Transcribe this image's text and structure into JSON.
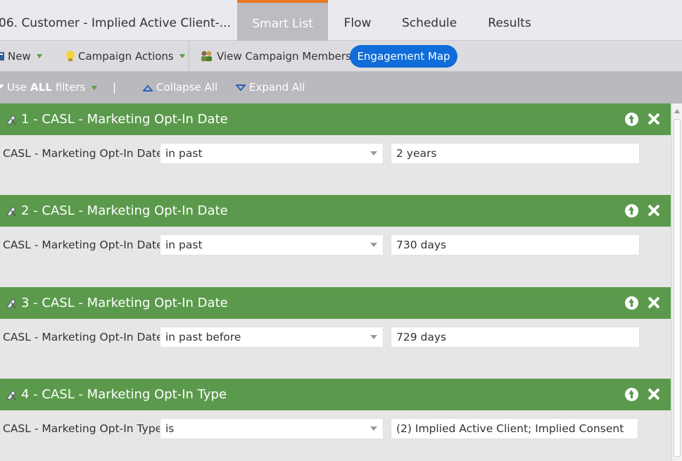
{
  "program_name": "06. Customer - Implied Active Client-...",
  "tabs": [
    {
      "label": "Smart List",
      "active": true
    },
    {
      "label": "Flow",
      "active": false
    },
    {
      "label": "Schedule",
      "active": false
    },
    {
      "label": "Results",
      "active": false
    }
  ],
  "toolbar": {
    "new_label": "New",
    "campaign_actions_label": "Campaign Actions",
    "view_members_label": "View Campaign Members",
    "engagement_map_label": "Engagement Map"
  },
  "filterbar": {
    "use_prefix": "Use ",
    "use_bold": "ALL",
    "use_suffix": " filters",
    "separator": "|",
    "collapse_label": "Collapse All",
    "expand_label": "Expand All"
  },
  "filters": [
    {
      "title": "1 - CASL - Marketing Opt-In Date",
      "field_label": "CASL - Marketing Opt-In Date:",
      "operator": "in past",
      "value": "2 years"
    },
    {
      "title": "2 - CASL - Marketing Opt-In Date",
      "field_label": "CASL - Marketing Opt-In Date:",
      "operator": "in past",
      "value": "730 days"
    },
    {
      "title": "3 - CASL - Marketing Opt-In Date",
      "field_label": "CASL - Marketing Opt-In Date:",
      "operator": "in past before",
      "value": "729 days"
    },
    {
      "title": "4 - CASL - Marketing Opt-In Type",
      "field_label": "CASL - Marketing Opt-In Type:",
      "operator": "is",
      "value": "(2) Implied Active Client; Implied Consent"
    }
  ],
  "colors": {
    "accent_tab": "#e87722",
    "filter_header": "#5b9a4c",
    "engagement_button": "#0f6cd9"
  }
}
